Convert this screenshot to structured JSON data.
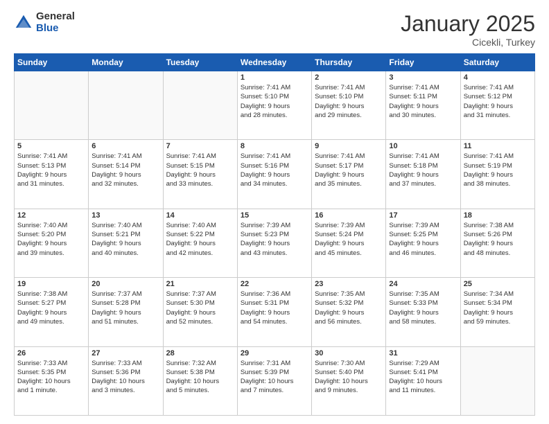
{
  "logo": {
    "general": "General",
    "blue": "Blue"
  },
  "header": {
    "month": "January 2025",
    "location": "Cicekli, Turkey"
  },
  "weekdays": [
    "Sunday",
    "Monday",
    "Tuesday",
    "Wednesday",
    "Thursday",
    "Friday",
    "Saturday"
  ],
  "weeks": [
    [
      {
        "day": "",
        "info": ""
      },
      {
        "day": "",
        "info": ""
      },
      {
        "day": "",
        "info": ""
      },
      {
        "day": "1",
        "info": "Sunrise: 7:41 AM\nSunset: 5:10 PM\nDaylight: 9 hours\nand 28 minutes."
      },
      {
        "day": "2",
        "info": "Sunrise: 7:41 AM\nSunset: 5:10 PM\nDaylight: 9 hours\nand 29 minutes."
      },
      {
        "day": "3",
        "info": "Sunrise: 7:41 AM\nSunset: 5:11 PM\nDaylight: 9 hours\nand 30 minutes."
      },
      {
        "day": "4",
        "info": "Sunrise: 7:41 AM\nSunset: 5:12 PM\nDaylight: 9 hours\nand 31 minutes."
      }
    ],
    [
      {
        "day": "5",
        "info": "Sunrise: 7:41 AM\nSunset: 5:13 PM\nDaylight: 9 hours\nand 31 minutes."
      },
      {
        "day": "6",
        "info": "Sunrise: 7:41 AM\nSunset: 5:14 PM\nDaylight: 9 hours\nand 32 minutes."
      },
      {
        "day": "7",
        "info": "Sunrise: 7:41 AM\nSunset: 5:15 PM\nDaylight: 9 hours\nand 33 minutes."
      },
      {
        "day": "8",
        "info": "Sunrise: 7:41 AM\nSunset: 5:16 PM\nDaylight: 9 hours\nand 34 minutes."
      },
      {
        "day": "9",
        "info": "Sunrise: 7:41 AM\nSunset: 5:17 PM\nDaylight: 9 hours\nand 35 minutes."
      },
      {
        "day": "10",
        "info": "Sunrise: 7:41 AM\nSunset: 5:18 PM\nDaylight: 9 hours\nand 37 minutes."
      },
      {
        "day": "11",
        "info": "Sunrise: 7:41 AM\nSunset: 5:19 PM\nDaylight: 9 hours\nand 38 minutes."
      }
    ],
    [
      {
        "day": "12",
        "info": "Sunrise: 7:40 AM\nSunset: 5:20 PM\nDaylight: 9 hours\nand 39 minutes."
      },
      {
        "day": "13",
        "info": "Sunrise: 7:40 AM\nSunset: 5:21 PM\nDaylight: 9 hours\nand 40 minutes."
      },
      {
        "day": "14",
        "info": "Sunrise: 7:40 AM\nSunset: 5:22 PM\nDaylight: 9 hours\nand 42 minutes."
      },
      {
        "day": "15",
        "info": "Sunrise: 7:39 AM\nSunset: 5:23 PM\nDaylight: 9 hours\nand 43 minutes."
      },
      {
        "day": "16",
        "info": "Sunrise: 7:39 AM\nSunset: 5:24 PM\nDaylight: 9 hours\nand 45 minutes."
      },
      {
        "day": "17",
        "info": "Sunrise: 7:39 AM\nSunset: 5:25 PM\nDaylight: 9 hours\nand 46 minutes."
      },
      {
        "day": "18",
        "info": "Sunrise: 7:38 AM\nSunset: 5:26 PM\nDaylight: 9 hours\nand 48 minutes."
      }
    ],
    [
      {
        "day": "19",
        "info": "Sunrise: 7:38 AM\nSunset: 5:27 PM\nDaylight: 9 hours\nand 49 minutes."
      },
      {
        "day": "20",
        "info": "Sunrise: 7:37 AM\nSunset: 5:28 PM\nDaylight: 9 hours\nand 51 minutes."
      },
      {
        "day": "21",
        "info": "Sunrise: 7:37 AM\nSunset: 5:30 PM\nDaylight: 9 hours\nand 52 minutes."
      },
      {
        "day": "22",
        "info": "Sunrise: 7:36 AM\nSunset: 5:31 PM\nDaylight: 9 hours\nand 54 minutes."
      },
      {
        "day": "23",
        "info": "Sunrise: 7:35 AM\nSunset: 5:32 PM\nDaylight: 9 hours\nand 56 minutes."
      },
      {
        "day": "24",
        "info": "Sunrise: 7:35 AM\nSunset: 5:33 PM\nDaylight: 9 hours\nand 58 minutes."
      },
      {
        "day": "25",
        "info": "Sunrise: 7:34 AM\nSunset: 5:34 PM\nDaylight: 9 hours\nand 59 minutes."
      }
    ],
    [
      {
        "day": "26",
        "info": "Sunrise: 7:33 AM\nSunset: 5:35 PM\nDaylight: 10 hours\nand 1 minute."
      },
      {
        "day": "27",
        "info": "Sunrise: 7:33 AM\nSunset: 5:36 PM\nDaylight: 10 hours\nand 3 minutes."
      },
      {
        "day": "28",
        "info": "Sunrise: 7:32 AM\nSunset: 5:38 PM\nDaylight: 10 hours\nand 5 minutes."
      },
      {
        "day": "29",
        "info": "Sunrise: 7:31 AM\nSunset: 5:39 PM\nDaylight: 10 hours\nand 7 minutes."
      },
      {
        "day": "30",
        "info": "Sunrise: 7:30 AM\nSunset: 5:40 PM\nDaylight: 10 hours\nand 9 minutes."
      },
      {
        "day": "31",
        "info": "Sunrise: 7:29 AM\nSunset: 5:41 PM\nDaylight: 10 hours\nand 11 minutes."
      },
      {
        "day": "",
        "info": ""
      }
    ]
  ]
}
